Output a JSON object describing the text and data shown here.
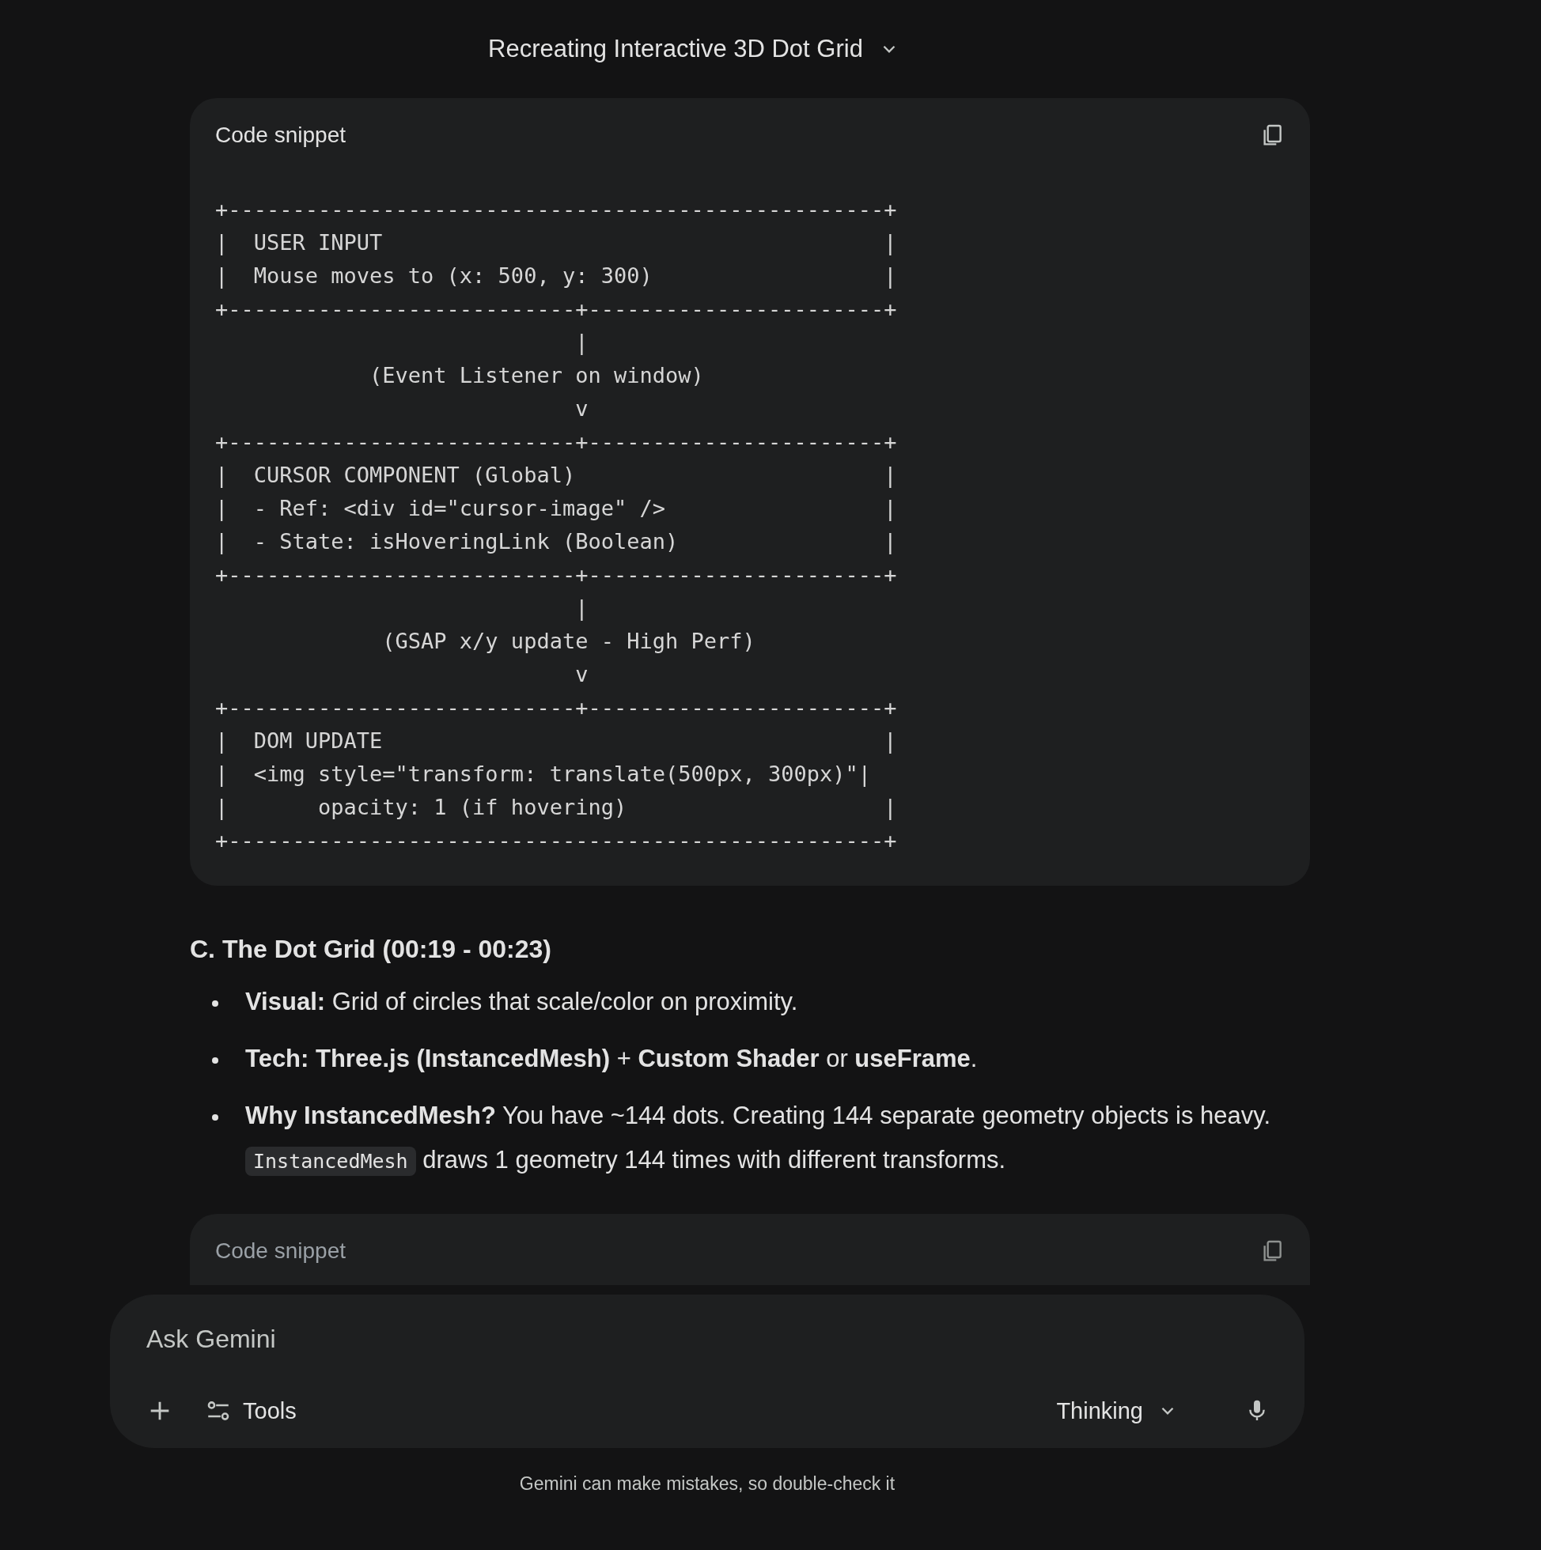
{
  "conversation": {
    "title": "Recreating Interactive 3D Dot Grid"
  },
  "code_block": {
    "label": "Code snippet",
    "lines": [
      "+---------------------------------------------------+",
      "|  USER INPUT                                       |",
      "|  Mouse moves to (x: 500, y: 300)                  |",
      "+---------------------------+-----------------------+",
      "                            |",
      "            (Event Listener on window)",
      "                            v",
      "+---------------------------+-----------------------+",
      "|  CURSOR COMPONENT (Global)                        |",
      "|  - Ref: <div id=\"cursor-image\" />                 |",
      "|  - State: isHoveringLink (Boolean)                |",
      "+---------------------------+-----------------------+",
      "                            |",
      "             (GSAP x/y update - High Perf)",
      "                            v",
      "+---------------------------+-----------------------+",
      "|  DOM UPDATE                                       |",
      "|  <img style=\"transform: translate(500px, 300px)\"|",
      "|       opacity: 1 (if hovering)                    |",
      "+---------------------------------------------------+"
    ]
  },
  "section": {
    "heading": "C. The Dot Grid (00:19 - 00:23)",
    "bullets": [
      [
        {
          "kind": "text",
          "text": "**Visual:** Grid of circles that scale/color on proximity."
        }
      ],
      [
        {
          "kind": "text",
          "text": "**Tech: Three.js (InstancedMesh)** + **Custom Shader** or **useFrame**."
        }
      ],
      [
        {
          "kind": "text",
          "text": "**Why InstancedMesh?** You have ~144 dots. Creating 144 separate geometry objects is heavy. "
        },
        {
          "kind": "code",
          "text": "InstancedMesh"
        },
        {
          "kind": "text",
          "text": " draws 1 geometry 144 times with different transforms."
        }
      ]
    ]
  },
  "code_block_2": {
    "label": "Code snippet"
  },
  "prompt": {
    "placeholder": "Ask Gemini",
    "tools_label": "Tools",
    "mode": "Thinking"
  },
  "disclaimer": "Gemini can make mistakes, so double-check it"
}
